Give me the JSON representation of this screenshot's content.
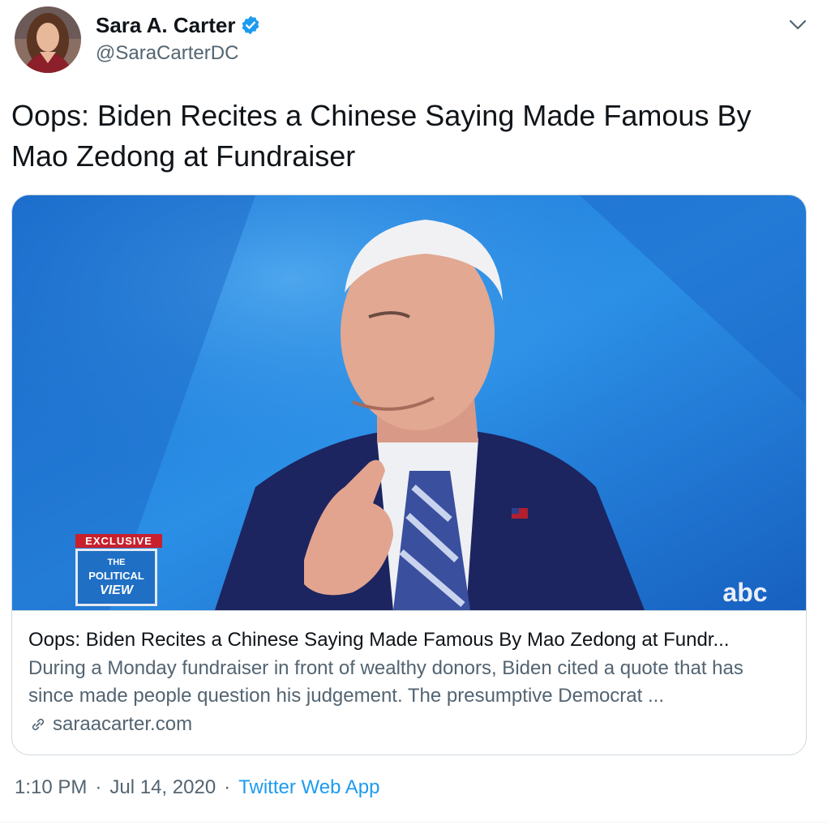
{
  "author": {
    "display_name": "Sara A. Carter",
    "handle": "@SaraCarterDC",
    "verified": true,
    "avatar_icon": "profile-photo"
  },
  "tweet": {
    "text": "Oops: Biden Recites a Chinese Saying Made Famous By Mao Zedong at Fundraiser"
  },
  "card": {
    "title": "Oops: Biden Recites a Chinese Saying Made Famous By Mao Zedong at Fundr...",
    "description": "During a Monday fundraiser in front of wealthy donors, Biden cited a quote that has since made people question his judgement. The presumptive Democrat ...",
    "domain": "saraacarter.com",
    "media": {
      "badge_top": "EXCLUSIVE",
      "badge_line1": "THE",
      "badge_line2": "POLITICAL",
      "badge_line3": "VIEW",
      "network_logo": "abc"
    }
  },
  "meta": {
    "time": "1:10 PM",
    "date": "Jul 14, 2020",
    "separator": "·",
    "source": "Twitter Web App"
  },
  "colors": {
    "text_primary": "#0f1419",
    "text_secondary": "#536471",
    "accent": "#1d9bf0",
    "border": "#cfd9de"
  }
}
